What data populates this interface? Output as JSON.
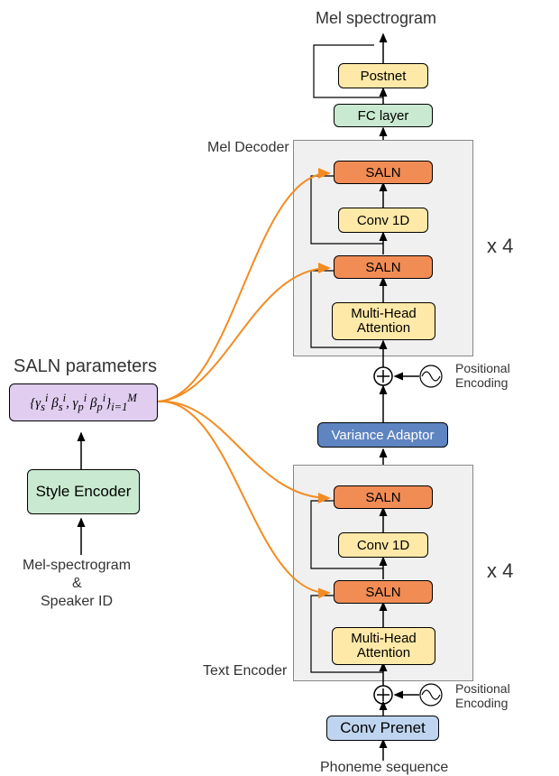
{
  "title": "Mel spectrogram",
  "bottom_input": "Phoneme sequence",
  "conv_prenet": "Conv Prenet",
  "text_encoder_label": "Text Encoder",
  "mel_decoder_label": "Mel Decoder",
  "repeat_label": "x 4",
  "variance_adaptor": "Variance Adaptor",
  "blocks": {
    "mha": "Multi-Head Attention",
    "saln": "SALN",
    "conv1d": "Conv 1D",
    "fc": "FC layer",
    "postnet": "Postnet"
  },
  "positional_encoding": "Positional Encoding",
  "saln_params_title": "SALN parameters",
  "saln_params_formula_left": "{γ",
  "saln_params_formula": "{γsᵢ βsᵢ, γpᵢ βpᵢ}ᵢ₌₁ᴹ",
  "style_encoder": "Style Encoder",
  "style_input_1": "Mel-spectrogram",
  "style_input_amp": "&",
  "style_input_2": "Speaker ID"
}
